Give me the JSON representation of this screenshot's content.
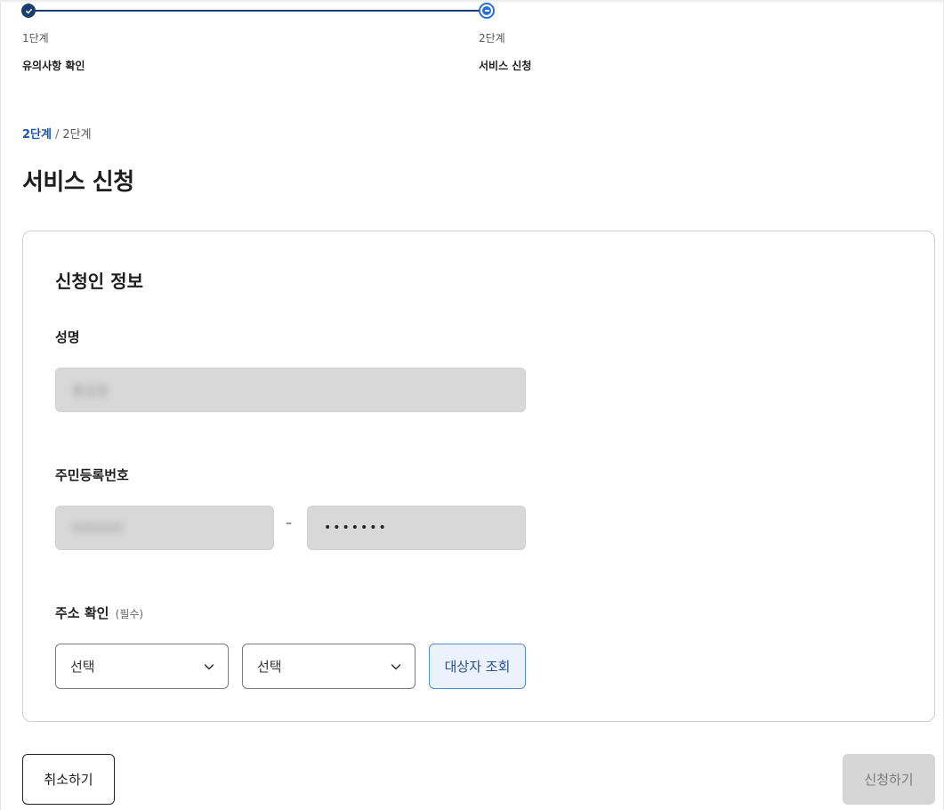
{
  "stepper": {
    "steps": [
      {
        "number": "1단계",
        "name": "유의사항 확인",
        "status": "done"
      },
      {
        "number": "2단계",
        "name": "서비스 신청",
        "status": "current"
      }
    ]
  },
  "breadcrumb": {
    "current": "2단계",
    "separator": "/",
    "total": "2단계"
  },
  "page_title": "서비스 신청",
  "applicant": {
    "section_title": "신청인 정보",
    "name_label": "성명",
    "name_value": "홍길동",
    "rrn_label": "주민등록번호",
    "rrn_front": "000000",
    "rrn_separator": "–",
    "rrn_back_masked": "•••••••",
    "address_label": "주소 확인",
    "address_required": "(필수)",
    "address_select_1": "선택",
    "address_select_2": "선택",
    "lookup_button": "대상자 조회"
  },
  "actions": {
    "cancel": "취소하기",
    "submit": "신청하기"
  },
  "colors": {
    "primary": "#1a3d6e",
    "accent": "#2b6fd6",
    "disabled": "#d6d6d6"
  }
}
